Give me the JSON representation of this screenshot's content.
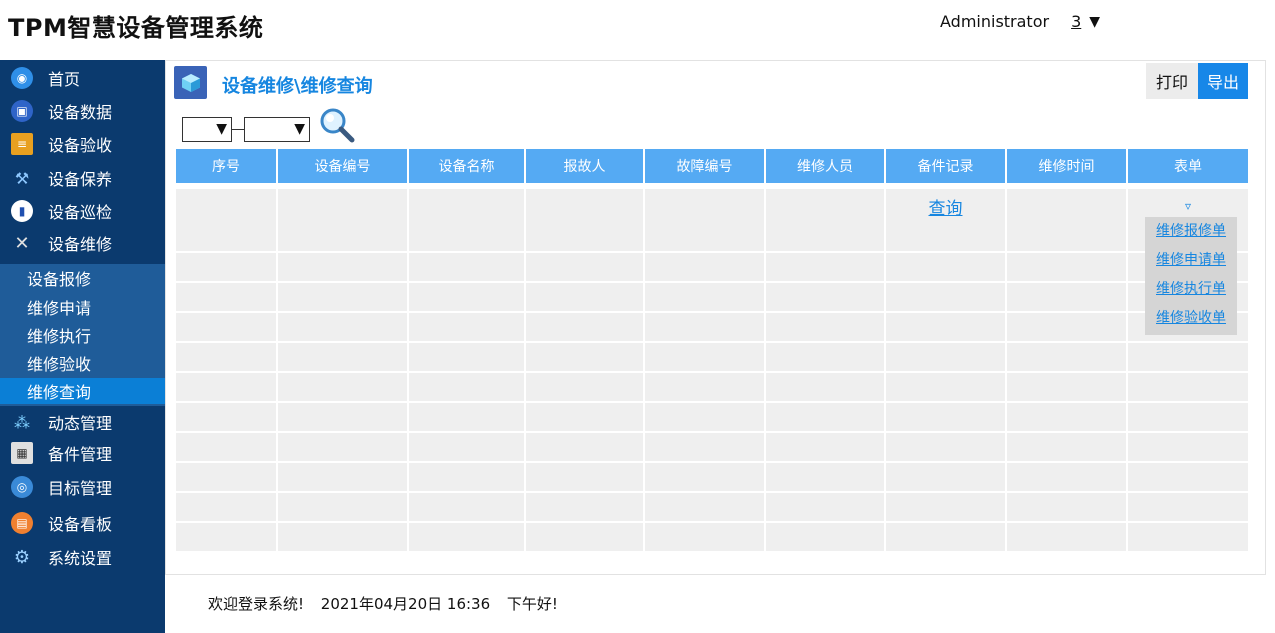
{
  "app": {
    "title": "TPM智慧设备管理系统"
  },
  "user": {
    "name": "Administrator",
    "count": "3"
  },
  "sidebar": {
    "items": [
      {
        "label": "首页",
        "icon": "home-icon",
        "color": "#2f8fe8"
      },
      {
        "label": "设备数据",
        "icon": "monitor-icon",
        "color": "#2f64c8"
      },
      {
        "label": "设备验收",
        "icon": "clipboard-icon",
        "color": "#e8a020"
      },
      {
        "label": "设备保养",
        "icon": "tools-icon",
        "color": "#4a8fd8"
      },
      {
        "label": "设备巡检",
        "icon": "inspection-icon",
        "color": "#2050b0"
      },
      {
        "label": "设备维修",
        "icon": "repair-icon",
        "color": "#8a8a8a"
      },
      {
        "label": "动态管理",
        "icon": "share-icon",
        "color": "#3aa0e8"
      },
      {
        "label": "备件管理",
        "icon": "calendar-icon",
        "color": "#7a7a7a"
      },
      {
        "label": "目标管理",
        "icon": "target-icon",
        "color": "#3a8ad8"
      },
      {
        "label": "设备看板",
        "icon": "dashboard-icon",
        "color": "#f08030"
      },
      {
        "label": "系统设置",
        "icon": "gear-icon",
        "color": "#5a9ad8"
      }
    ],
    "submenu": [
      {
        "label": "设备报修"
      },
      {
        "label": "维修申请"
      },
      {
        "label": "维修执行"
      },
      {
        "label": "维修验收"
      },
      {
        "label": "维修查询"
      }
    ]
  },
  "page": {
    "title": "设备维修\\维修查询",
    "print_label": "打印",
    "export_label": "导出"
  },
  "table": {
    "columns": [
      "序号",
      "设备编号",
      "设备名称",
      "报故人",
      "故障编号",
      "维修人员",
      "备件记录",
      "维修时间",
      "表单"
    ],
    "first_row": {
      "spare_link": "查询",
      "form_toggle": "▿"
    },
    "empty_rows": 12
  },
  "form_menu": [
    "维修报修单",
    "维修申请单",
    "维修执行单",
    "维修验收单"
  ],
  "footer": {
    "welcome": "欢迎登录系统!",
    "datetime": "2021年04月20日 16:36",
    "greeting": "下午好!"
  }
}
